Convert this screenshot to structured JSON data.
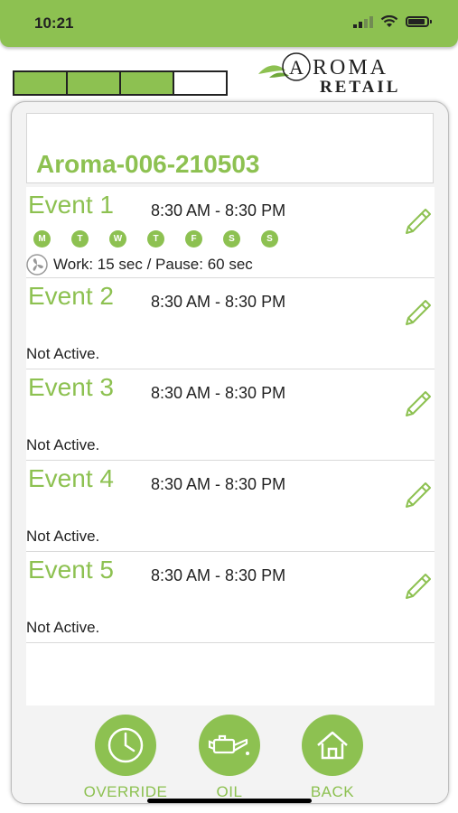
{
  "status_bar": {
    "time": "10:21",
    "signal_icon": "cellular-signal-icon",
    "wifi_icon": "wifi-icon",
    "battery_icon": "battery-icon"
  },
  "progress": {
    "filled_segments": 3,
    "total_segments": 4
  },
  "logo": {
    "line1": "ROMA",
    "letter": "A",
    "line2": "RETAIL"
  },
  "device": {
    "name": "Aroma-006-210503"
  },
  "events": [
    {
      "title": "Event 1",
      "time": "8:30 AM - 8:30 PM",
      "days": [
        "M",
        "T",
        "W",
        "T",
        "F",
        "S",
        "S"
      ],
      "detail": "Work: 15 sec / Pause: 60 sec"
    },
    {
      "title": "Event 2",
      "time": "8:30 AM - 8:30 PM",
      "status": "Not Active."
    },
    {
      "title": "Event 3",
      "time": "8:30 AM - 8:30 PM",
      "status": "Not Active."
    },
    {
      "title": "Event 4",
      "time": "8:30 AM - 8:30 PM",
      "status": "Not Active."
    },
    {
      "title": "Event 5",
      "time": "8:30 AM - 8:30 PM",
      "status": "Not Active."
    }
  ],
  "nav": {
    "override": "OVERRIDE",
    "oil": "OIL",
    "back": "BACK"
  },
  "colors": {
    "accent": "#8dc151",
    "text": "#222222",
    "panel": "#f3f3f3"
  }
}
